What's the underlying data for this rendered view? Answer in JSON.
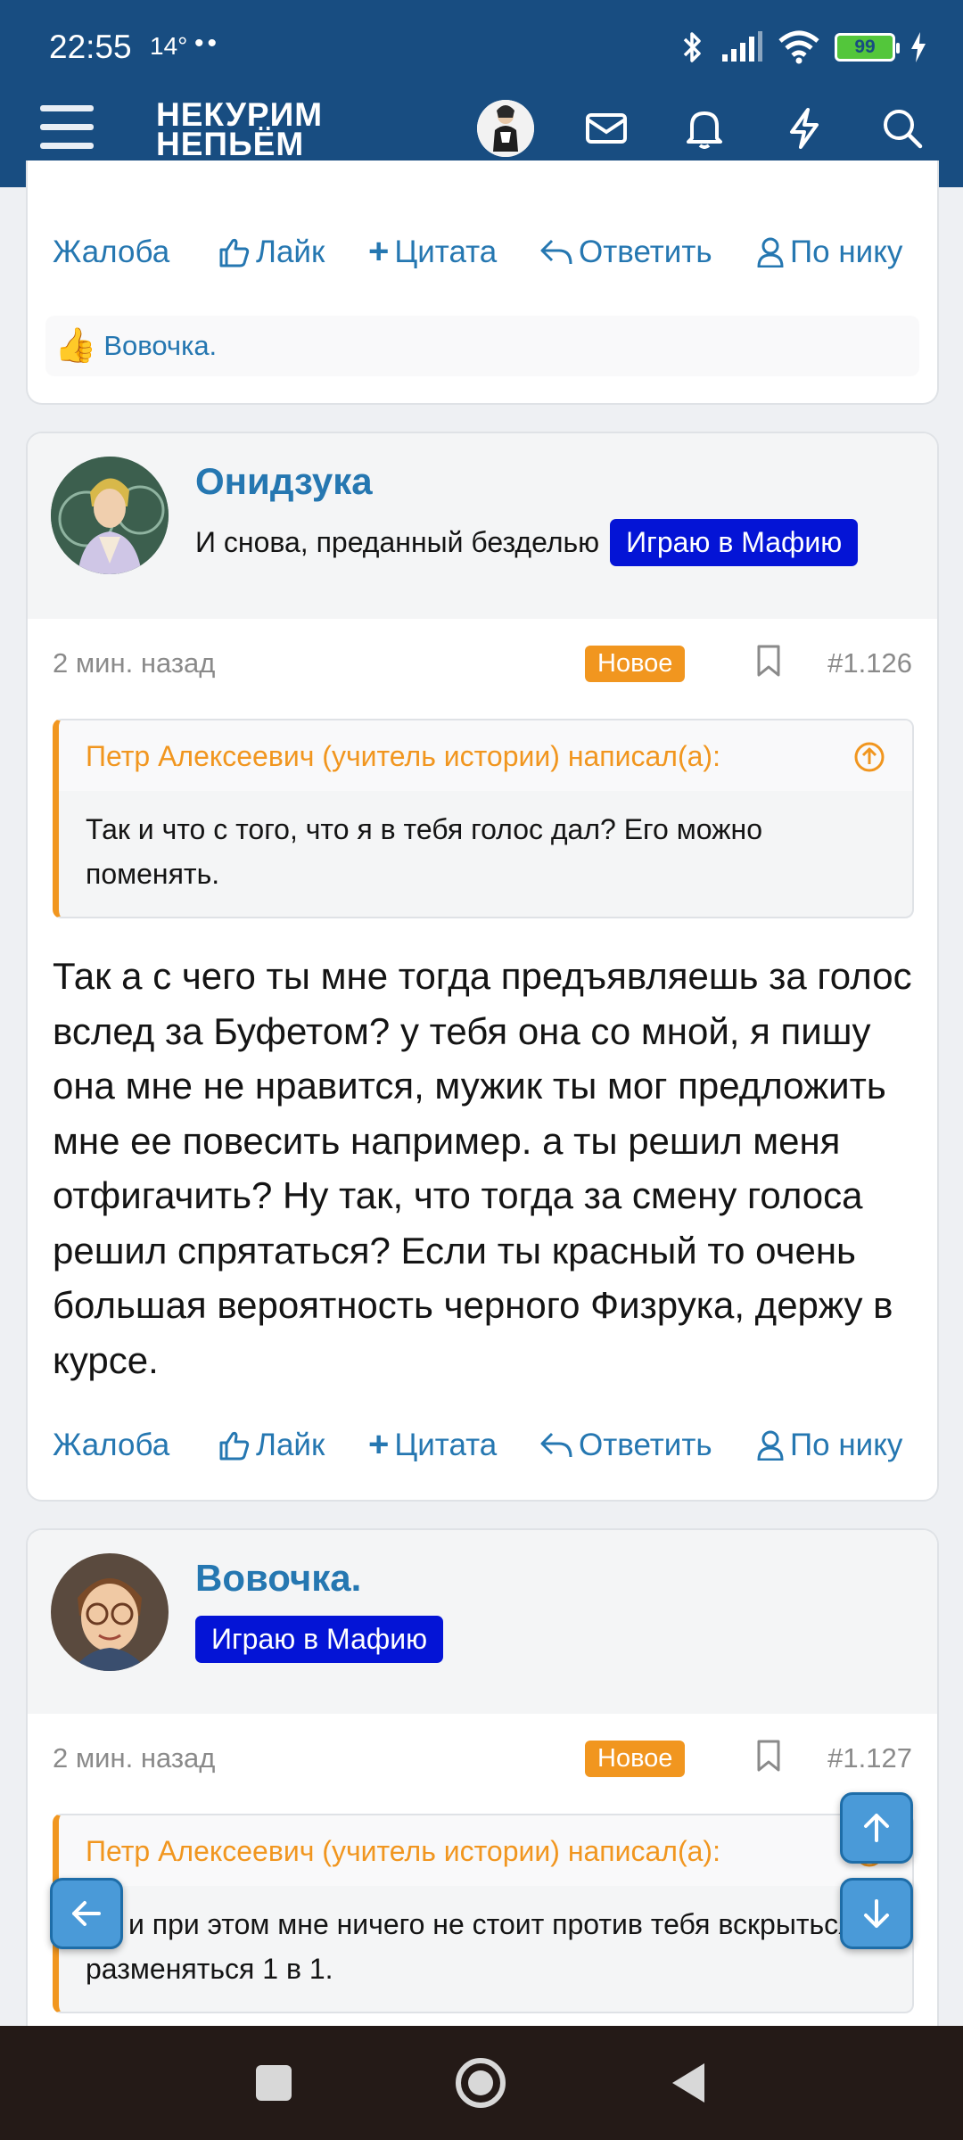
{
  "status_bar": {
    "time": "22:55",
    "temperature": "14°",
    "dots": "••",
    "battery": "99"
  },
  "header": {
    "logo_line1": "НЕКУРИМ",
    "logo_line2": "НЕПЬЁМ"
  },
  "actions": {
    "report": "Жалоба",
    "like": "Лайк",
    "quote": "Цитата",
    "reply": "Ответить",
    "by_nick": "По нику"
  },
  "card_top": {
    "reaction_user": "Вовочка."
  },
  "post1": {
    "author": "Онидзука",
    "user_title": "И снова, преданный безделью",
    "banner": "Играю в Мафию",
    "time": "2 мин. назад",
    "badge": "Новое",
    "number": "#1.126",
    "quote_author": "Петр Алексеевич (учитель истории) написал(а):",
    "quote_text": "Так и что с того, что я в тебя голос дал? Его можно поменять.",
    "body": "Так а с чего ты мне тогда предъявляешь за голос вслед за Буфетом? у тебя она со мной, я пишу она мне не нравится, мужик ты мог предложить мне ее повесить например. а ты решил меня отфигачить? Ну так, что тогда за смену голоса решил спрятаться? Если ты красный то очень большая вероятность черного Физрука, держу в курсе."
  },
  "post2": {
    "author": "Вовочка.",
    "banner": "Играю в Мафию",
    "time": "2 мин. назад",
    "badge": "Новое",
    "number": "#1.127",
    "quote_author": "Петр Алексеевич (учитель истории) написал(а):",
    "quote_text": "Ну и при этом мне ничего не стоит против тебя вскрыться и разменяться 1 в 1."
  },
  "colors": {
    "header": "#184d81",
    "link": "#2577b1",
    "accent": "#f1961f",
    "banner": "#0414d6"
  }
}
